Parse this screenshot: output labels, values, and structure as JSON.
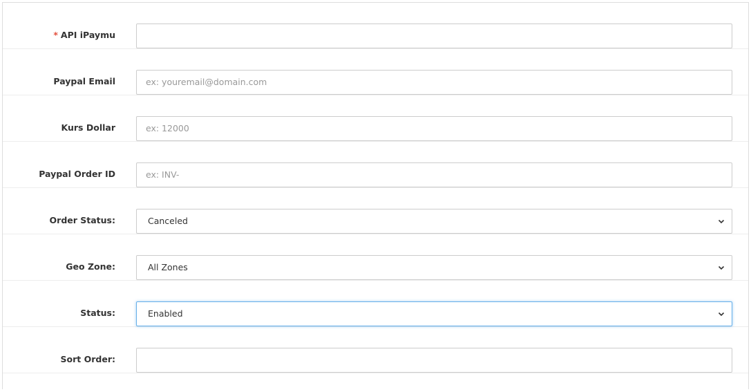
{
  "form": {
    "fields": [
      {
        "label": "API iPaymu",
        "required": true,
        "type": "text",
        "value": "",
        "placeholder": ""
      },
      {
        "label": "Paypal Email",
        "type": "text",
        "value": "",
        "placeholder": "ex: youremail@domain.com"
      },
      {
        "label": "Kurs Dollar",
        "type": "text",
        "value": "",
        "placeholder": "ex: 12000"
      },
      {
        "label": "Paypal Order ID",
        "type": "text",
        "value": "",
        "placeholder": "ex: INV-"
      },
      {
        "label": "Order Status:",
        "type": "select",
        "value": "Canceled"
      },
      {
        "label": "Geo Zone:",
        "type": "select",
        "value": "All Zones"
      },
      {
        "label": "Status:",
        "type": "select",
        "value": "Enabled",
        "focused": true
      },
      {
        "label": "Sort Order:",
        "type": "text",
        "value": "",
        "placeholder": ""
      }
    ],
    "required_marker": "*"
  },
  "colors": {
    "required": "#e3503e",
    "focus_border": "#66afe9",
    "border": "#cccccc",
    "label": "#333333"
  },
  "icons": {
    "select_arrow": "chevron-down-icon"
  }
}
